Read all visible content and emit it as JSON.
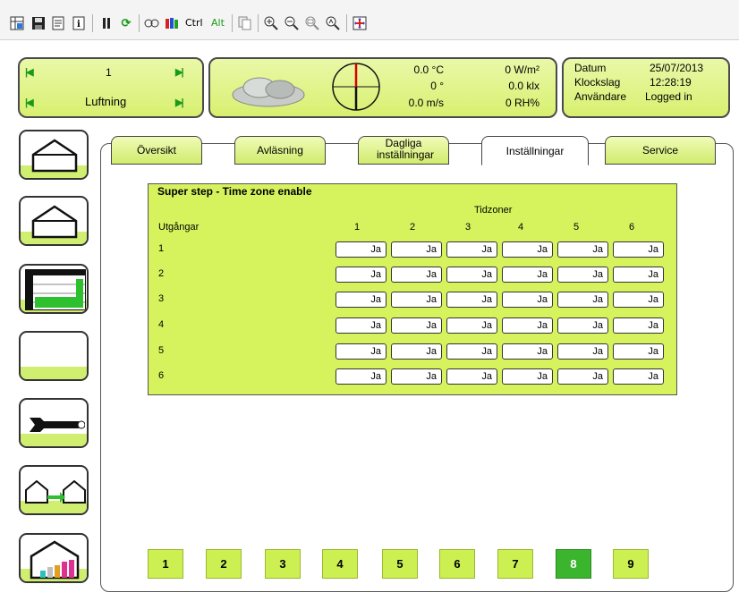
{
  "toolbar": {
    "icons": [
      "grid-icon",
      "save-icon",
      "properties-icon",
      "info-icon",
      "pause-icon",
      "refresh-icon",
      "keys-icon",
      "colors-icon",
      "ctrl-key",
      "alt-key",
      "copy-icon",
      "zoom-in-icon",
      "zoom-out-icon",
      "zoom-fit-icon",
      "zoom-custom-icon",
      "fullscreen-icon"
    ],
    "ctrl_label": "Ctrl",
    "alt_label": "Alt"
  },
  "section": {
    "number": "1",
    "name": "Luftning"
  },
  "weather": {
    "temperature": "0.0 °C",
    "direction": "0 °",
    "wind_speed": "0.0 m/s",
    "radiation": "0 W/m²",
    "light": "0.0 klx",
    "humidity": "0 RH%"
  },
  "info": {
    "date_label": "Datum",
    "date_value": "25/07/2013",
    "time_label": "Klockslag",
    "time_value": "12:28:19",
    "user_label": "Användare",
    "user_value": "Logged in"
  },
  "sidenav": [
    "greenhouse-icon",
    "greenhouse-icon",
    "graph-icon",
    "blank-button",
    "wrench-icon",
    "connected-greenhouses-icon",
    "greenhouse-chart-icon"
  ],
  "tabs": [
    {
      "label": "Översikt",
      "active": false
    },
    {
      "label": "Avläsning",
      "active": false
    },
    {
      "label": "Dagliga inställningar",
      "active": false
    },
    {
      "label": "Inställningar",
      "active": true
    },
    {
      "label": "Service",
      "active": false
    }
  ],
  "grid": {
    "title": "Super step - Time zone enable",
    "group_label": "Tidzoner",
    "row_header": "Utgångar",
    "columns": [
      "1",
      "2",
      "3",
      "4",
      "5",
      "6"
    ],
    "rows": [
      {
        "label": "1",
        "values": [
          "Ja",
          "Ja",
          "Ja",
          "Ja",
          "Ja",
          "Ja"
        ]
      },
      {
        "label": "2",
        "values": [
          "Ja",
          "Ja",
          "Ja",
          "Ja",
          "Ja",
          "Ja"
        ]
      },
      {
        "label": "3",
        "values": [
          "Ja",
          "Ja",
          "Ja",
          "Ja",
          "Ja",
          "Ja"
        ]
      },
      {
        "label": "4",
        "values": [
          "Ja",
          "Ja",
          "Ja",
          "Ja",
          "Ja",
          "Ja"
        ]
      },
      {
        "label": "5",
        "values": [
          "Ja",
          "Ja",
          "Ja",
          "Ja",
          "Ja",
          "Ja"
        ]
      },
      {
        "label": "6",
        "values": [
          "Ja",
          "Ja",
          "Ja",
          "Ja",
          "Ja",
          "Ja"
        ]
      }
    ]
  },
  "pages": [
    "1",
    "2",
    "3",
    "4",
    "5",
    "6",
    "7",
    "8",
    "9"
  ],
  "active_page": "8",
  "colors": {
    "accent": "#d6f35e",
    "active_page": "#3cb52e"
  }
}
